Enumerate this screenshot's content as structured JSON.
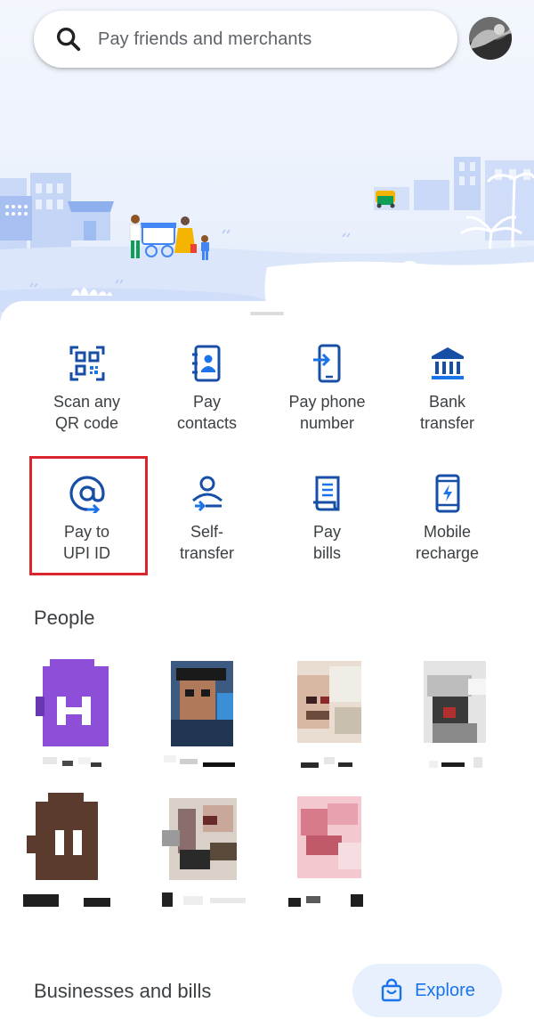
{
  "search": {
    "placeholder": "Pay friends and merchants"
  },
  "actions": [
    {
      "label": "Scan any\nQR code",
      "icon": "qr-code-scan-icon"
    },
    {
      "label": "Pay\ncontacts",
      "icon": "contacts-book-icon"
    },
    {
      "label": "Pay phone\nnumber",
      "icon": "phone-transfer-icon"
    },
    {
      "label": "Bank\ntransfer",
      "icon": "bank-icon"
    },
    {
      "label": "Pay to\nUPI ID",
      "icon": "at-sign-icon"
    },
    {
      "label": "Self-\ntransfer",
      "icon": "self-transfer-icon"
    },
    {
      "label": "Pay\nbills",
      "icon": "receipt-icon"
    },
    {
      "label": "Mobile\nrecharge",
      "icon": "mobile-recharge-icon"
    }
  ],
  "people": {
    "title": "People"
  },
  "businesses": {
    "title": "Businesses and bills",
    "explore_label": "Explore"
  },
  "colors": {
    "accent": "#1a73e8",
    "icon_navy": "#174ea6",
    "highlight": "#d9252b"
  }
}
